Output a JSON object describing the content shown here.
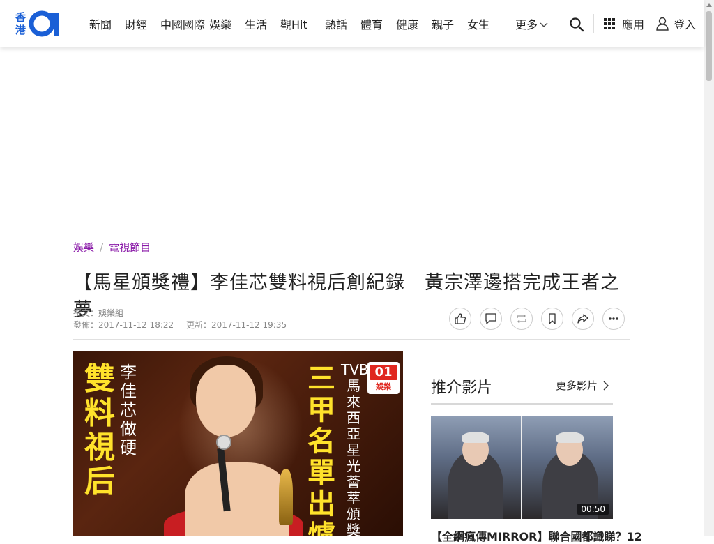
{
  "header": {
    "logo": {
      "line1": "香",
      "line2": "港",
      "mark": "01"
    },
    "nav": [
      {
        "label": "新聞"
      },
      {
        "label": "財經"
      },
      {
        "label": "中國國際"
      },
      {
        "label": "娛樂"
      },
      {
        "label": "生活"
      },
      {
        "label": "觀Hit"
      },
      {
        "label": "熱話"
      },
      {
        "label": "體育"
      },
      {
        "label": "健康"
      },
      {
        "label": "親子"
      },
      {
        "label": "女生"
      }
    ],
    "more_label": "更多",
    "apps_label": "應用",
    "login_label": "登入"
  },
  "article": {
    "breadcrumb": [
      "娛樂",
      "電視節目"
    ],
    "headline": "【馬星頒獎禮】李佳芯雙料視后創紀錄　黃宗澤邊搭完成王者之夢",
    "author": "撰文：娛樂組",
    "published": "發佈：2017-11-12 18:22",
    "updated": "更新：2017-11-12 19:35",
    "hero": {
      "title_left": "雙料視后",
      "sub_left": "李佳芯做硬",
      "title_right": "三甲名單出爐",
      "sub_right": "TVB馬來西亞星光薈萃頒獎典禮",
      "badge": "娛樂"
    }
  },
  "sidebar": {
    "title": "推介影片",
    "more_label": "更多影片",
    "video": {
      "duration": "00:50",
      "title": "【全網瘋傳MIRROR】聯合國都識睇？12"
    }
  },
  "colors": {
    "brand": "#1a5fd6",
    "breadcrumb": "#8a1aa8",
    "hero_text": "#ffe22b"
  }
}
